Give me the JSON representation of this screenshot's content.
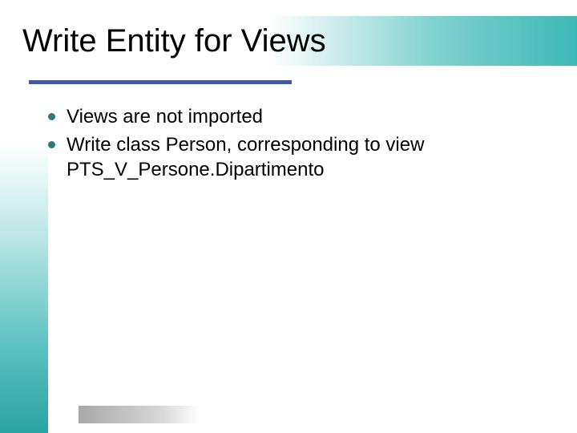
{
  "title": "Write Entity for Views",
  "bullets": [
    "Views are not imported",
    "Write class Person, corresponding to view PTS_V_Persone.Dipartimento"
  ]
}
